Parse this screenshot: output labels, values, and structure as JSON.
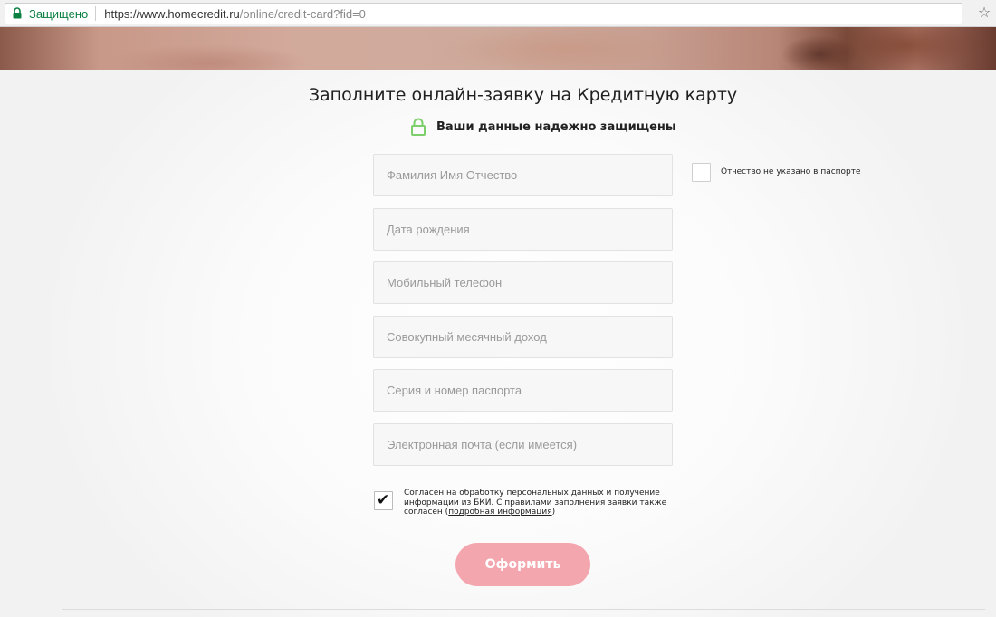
{
  "browser": {
    "secure_label": "Защищено",
    "url_host": "https://www.homecredit.ru",
    "url_path": "/online/credit-card?fid=0",
    "bookmark_icon": "star-icon"
  },
  "form": {
    "title": "Заполните онлайн-заявку на Кредитную карту",
    "secure_note": "Ваши данные надежно защищены",
    "fields": {
      "full_name": "Фамилия Имя Отчество",
      "birth_date": "Дата рождения",
      "mobile_phone": "Мобильный телефон",
      "monthly_income": "Совокупный месячный доход",
      "passport": "Серия и номер паспорта",
      "email": "Электронная почта (если имеется)"
    },
    "no_patronymic_label": "Отчество не указано в паспорте",
    "no_patronymic_checked": false,
    "consent": {
      "checked": true,
      "text_start": "Согласен на обработку персональных данных и получение информации из БКИ. С правилами заполнения заявки также согласен (",
      "link_text": "подробная информация",
      "text_end": ")"
    },
    "submit_label": "Оформить"
  },
  "colors": {
    "secure_green": "#0b8043",
    "lock_green": "#7ccf6a",
    "submit_pink": "#f4a6ae"
  }
}
